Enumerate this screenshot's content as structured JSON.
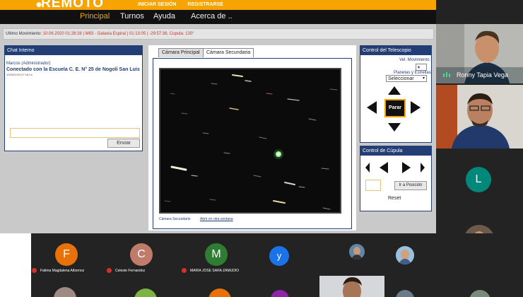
{
  "site": {
    "brand": "REMOTO",
    "auth_links": [
      "INICIAR SESIÓN",
      "REGISTRARSE"
    ],
    "nav": [
      "Principal",
      "Turnos",
      "Ayuda",
      "Acerca de .."
    ]
  },
  "status": {
    "label_movement": "Ultimo Movimiento: ",
    "value": "10.06.2020 01:28:28 | M83 - Galaxia Espiral | 01:13:05 | -29:57:38, Cupula: 130°"
  },
  "chat": {
    "title": "Chat Interno",
    "sender": "Marcos (Administrador)",
    "message": "Conectado con la Escuela C. E. N° 25 de Nogoli San Luis",
    "timestamp": "10/06/2020 07:18:24",
    "send_label": "Enviar"
  },
  "camera": {
    "tabs": [
      "Cámara Principal",
      "Cámara Secundaria"
    ],
    "active_tab": 1,
    "caption": "Cámara Secundario",
    "open_link": "Abrir en otra ventana"
  },
  "telescope": {
    "title": "Control del Telescopio",
    "speed_label": "Vel. Movimiento:",
    "planets_label": "Planetas y Estrellas:",
    "planets_select": "Seleccionar",
    "stop_label": "Parar"
  },
  "dome": {
    "title": "Control de Cúpula",
    "goto_label": "Ir a Posición",
    "reset_label": "Reset"
  },
  "meeting": {
    "participants": [
      {
        "initial": "F",
        "name": "Fatima Magdalena Albornoz",
        "color": "#e8710a"
      },
      {
        "initial": "C",
        "name": "Celeste Fernandez",
        "color": "#c07b6b"
      },
      {
        "initial": "M",
        "name": "MARIA JOSE SARA ZAMUDIO",
        "color": "#2e7d32"
      },
      {
        "initial": "y",
        "name": "",
        "color": "#1a73e8"
      }
    ],
    "right_tiles": [
      {
        "initial": "L",
        "color": "#00897b"
      }
    ],
    "video_tile_name": "Ronny Tapia Vega",
    "accent": "#f7a400"
  }
}
